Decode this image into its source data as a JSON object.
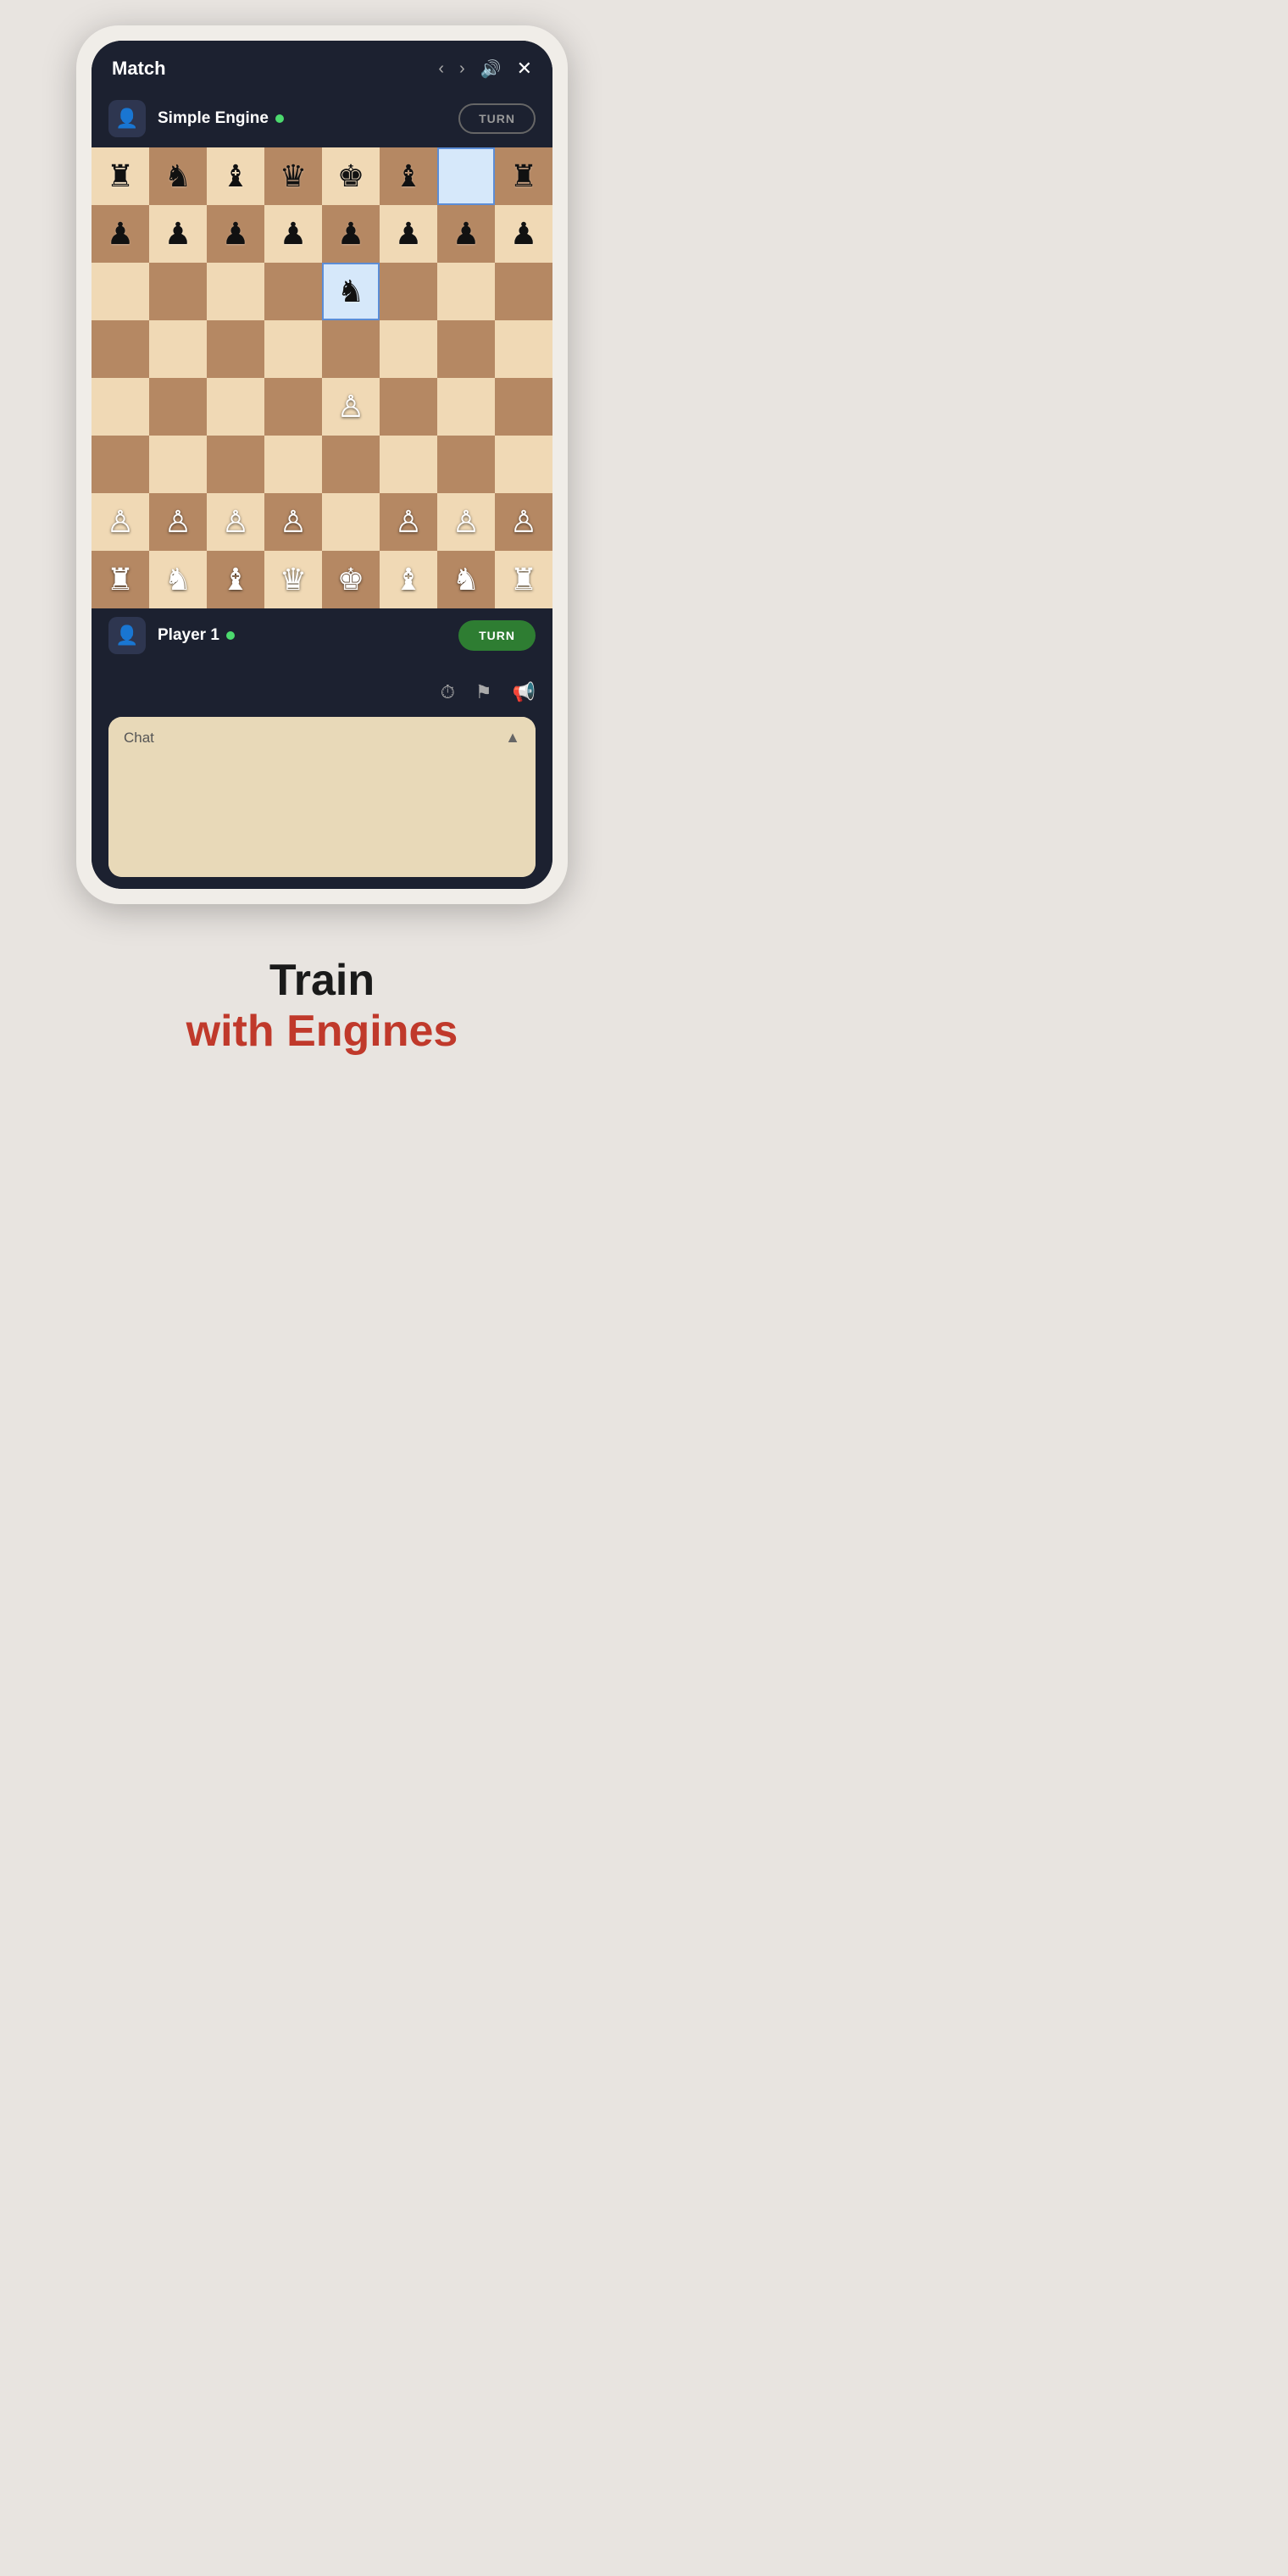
{
  "header": {
    "title": "Match",
    "back_icon": "‹",
    "forward_icon": "›",
    "sound_icon": "🔊",
    "close_icon": "✕"
  },
  "opponent": {
    "name": "Simple Engine",
    "online": true,
    "turn_label": "TURN",
    "avatar_icon": "👤"
  },
  "player": {
    "name": "Player 1",
    "online": true,
    "turn_label": "TURN",
    "avatar_icon": "👤"
  },
  "board": {
    "rows": [
      [
        "br",
        "bn",
        "bb",
        "bq",
        "bk",
        "bb",
        "",
        "br"
      ],
      [
        "bp",
        "bp",
        "bp",
        "bp",
        "bp",
        "bp",
        "bp",
        "bp"
      ],
      [
        "",
        "",
        "",
        "",
        "bn_hl",
        "",
        "",
        ""
      ],
      [
        "",
        "",
        "",
        "",
        "",
        "",
        "",
        ""
      ],
      [
        "",
        "",
        "",
        "",
        "wp",
        "",
        "",
        ""
      ],
      [
        "",
        "",
        "",
        "",
        "",
        "",
        "",
        ""
      ],
      [
        "wp",
        "wp",
        "wp",
        "wp",
        "",
        "wp",
        "wp",
        "wp"
      ],
      [
        "wr",
        "wn",
        "wb",
        "wq",
        "wk",
        "wb",
        "wn",
        "wr"
      ]
    ],
    "highlighted_cells": [
      [
        0,
        6
      ],
      [
        2,
        4
      ]
    ],
    "colors": {
      "light": "#f0d9b5",
      "dark": "#b58863",
      "highlight": "#d6e8fa"
    }
  },
  "actions": {
    "timer_icon": "⏱",
    "flag_icon": "⚑",
    "resign_icon": "📢"
  },
  "chat": {
    "label": "Chat",
    "chevron": "▲",
    "placeholder": ""
  },
  "marketing": {
    "line1": "Train",
    "line2": "with Engines"
  }
}
